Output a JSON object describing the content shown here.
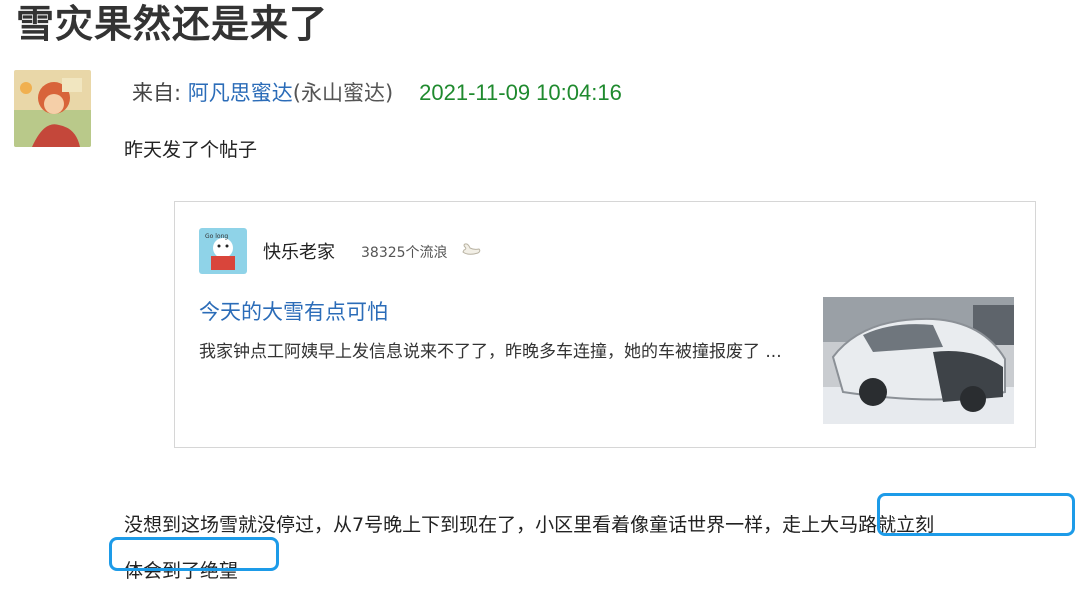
{
  "post": {
    "title": "雪灾果然还是来了",
    "from_label": "来自: ",
    "author": "阿凡思蜜达",
    "author_suffix": "(永山蜜达)",
    "datetime": "2021-11-09 10:04:16",
    "intro": "昨天发了个帖子"
  },
  "shared_card": {
    "user": "快乐老家",
    "count": "38325个流浪",
    "count_icon": "swan-icon",
    "title": "今天的大雪有点可怕",
    "excerpt": "我家钟点工阿姨早上发信息说来不了了，昨晚多车连撞，她的车被撞报废了 ..."
  },
  "body": {
    "line1_prefix": "没想到这场雪就没停过，从7号晚上下到现在了，小区里看着像童话世界一样，",
    "highlight_part1": "走上大马路就立刻",
    "highlight_part2": "体会到了绝望"
  },
  "colors": {
    "link_blue": "#2b6cb8",
    "date_green": "#1f8a2e",
    "highlight_border": "#1d9be8"
  }
}
